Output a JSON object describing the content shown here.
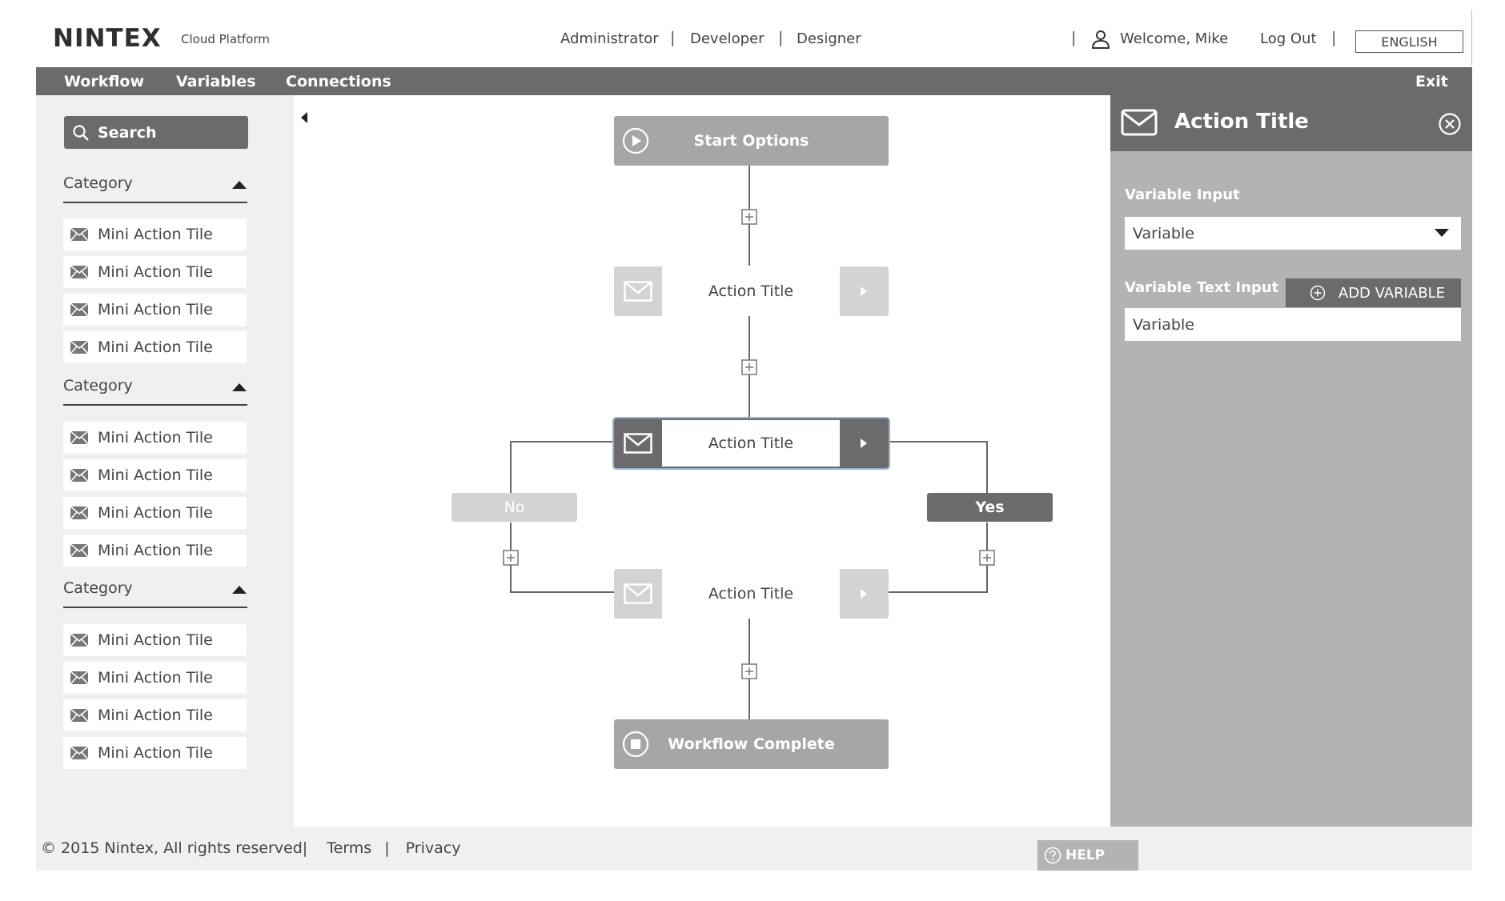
{
  "header": {
    "logo": "NINTEX",
    "logo_sub": "Cloud Platform",
    "roles": [
      "Administrator",
      "Developer",
      "Designer"
    ],
    "separator": "|",
    "welcome": "Welcome, Mike",
    "logout": "Log Out",
    "language": "ENGLISH"
  },
  "menu": {
    "items": [
      "Workflow",
      "Variables",
      "Connections"
    ],
    "exit": "Exit"
  },
  "sidebar": {
    "search_label": "Search",
    "categories": [
      {
        "title": "Category",
        "tiles": [
          "Mini Action Tile",
          "Mini Action Tile",
          "Mini Action Tile",
          "Mini Action Tile"
        ]
      },
      {
        "title": "Category",
        "tiles": [
          "Mini Action Tile",
          "Mini Action Tile",
          "Mini Action Tile",
          "Mini Action Tile"
        ]
      },
      {
        "title": "Category",
        "tiles": [
          "Mini Action Tile",
          "Mini Action Tile",
          "Mini Action Tile",
          "Mini Action Tile"
        ]
      }
    ]
  },
  "workflow": {
    "start": "Start Options",
    "action1": "Action Title",
    "action2": "Action Title",
    "action3": "Action Title",
    "branch_no": "No",
    "branch_yes": "Yes",
    "end": "Workflow Complete"
  },
  "panel": {
    "title": "Action Title",
    "variable_input_label": "Variable Input",
    "variable_select_value": "Variable",
    "variable_text_label": "Variable Text  Input",
    "add_variable": "ADD VARIABLE",
    "variable_text_value": "Variable"
  },
  "footer": {
    "copyright": "© 2015 Nintex, All rights reserved|",
    "terms": "Terms",
    "sep": "|",
    "privacy": "Privacy",
    "help": "HELP"
  },
  "colors": {
    "dark_gray": "#6b6b6b",
    "light_gray": "#d3d3d3",
    "panel_gray": "#b3b3b3",
    "sidebar_bg": "#f0f0f0",
    "selected_border": "#8fb3d9"
  }
}
